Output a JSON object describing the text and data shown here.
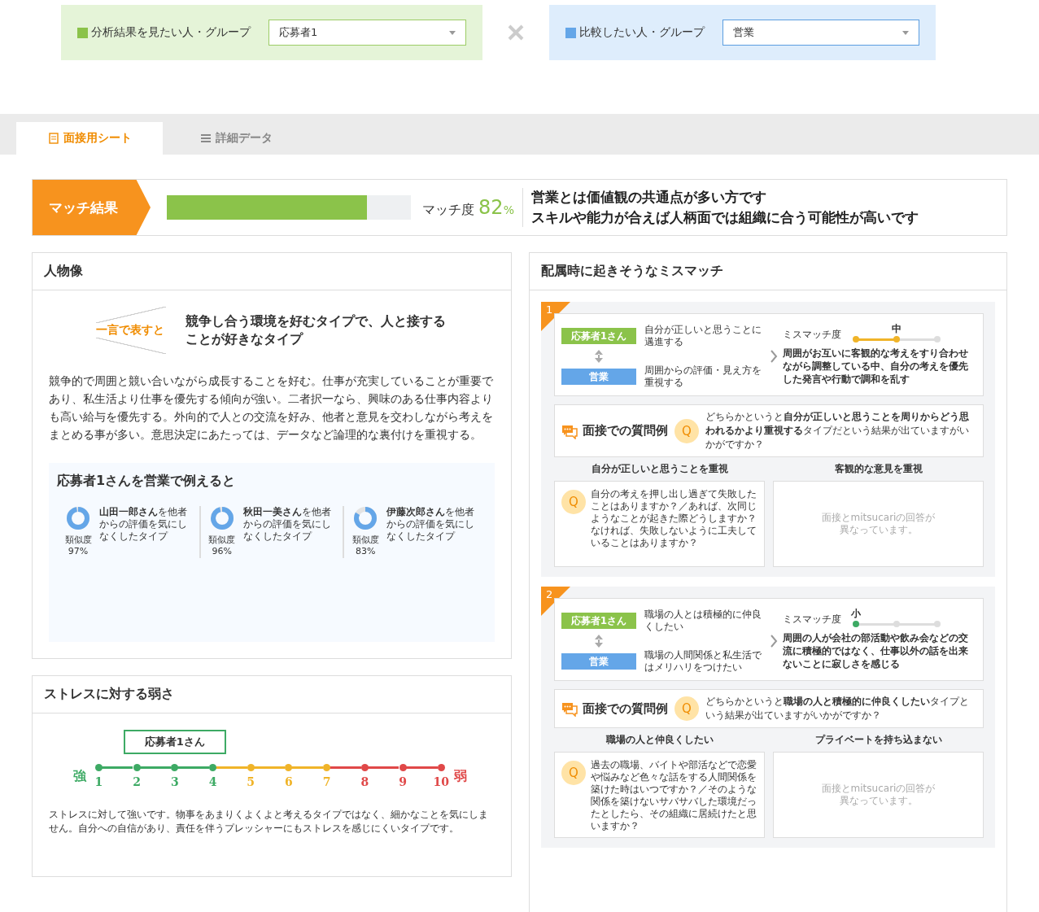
{
  "selectors": [
    {
      "label": "分析結果を見たい人・グループ",
      "value": "応募者1",
      "color": "#8bc34a"
    },
    {
      "label": "比較したい人・グループ",
      "value": "営業",
      "color": "#64a6e8"
    }
  ],
  "tabs": [
    {
      "label": "面接用シート",
      "kind": "sheet",
      "selected": true
    },
    {
      "label": "詳細データ",
      "kind": "list",
      "selected": false
    }
  ],
  "match": {
    "badge": "マッチ結果",
    "level": 0.82,
    "label": "マッチ度",
    "value": "82",
    "unit": "%",
    "summary": [
      "営業とは価値観の共通点が多い方です",
      "スキルや能力が合えば人柄面では組織に合う可能性が高いです"
    ]
  },
  "persona": {
    "title": "人物像",
    "tagline_label": "一言で表すと",
    "tagline": "競争し合う環境を好むタイプで、人と接することが好きなタイプ",
    "description": "競争的で周囲と競い合いながら成長することを好む。仕事が充実していることが重要であり、私生活より仕事を優先する傾向が強い。二者択一なら、興味のある仕事内容よりも高い給与を優先する。外向的で人との交流を好み、他者と意見を交わしながら考えをまとめる事が多い。意思決定にあたっては、データなど論理的な裏付けを重視する。",
    "examples_title": "応募者1さんを営業で例えると",
    "examples": [
      {
        "text": "**山田一郎さん**を他者からの評価を気にしなくしたタイプ",
        "similarity_label": "類似度",
        "similarity": "97%",
        "level": 0.97
      },
      {
        "text": "**秋田一美さん**を他者からの評価を気にしなくしたタイプ",
        "similarity_label": "類似度",
        "similarity": "96%",
        "level": 0.96
      },
      {
        "text": "**伊藤次郎さん**を他者からの評価を気にしなくしたタイプ",
        "similarity_label": "類似度",
        "similarity": "83%",
        "level": 0.83
      }
    ]
  },
  "stress": {
    "title": "ストレスに対する弱さ",
    "marker": "応募者1さん",
    "strong_label": "強",
    "weak_label": "弱",
    "points": [
      {
        "label": "1",
        "color": "#3daa64",
        "selected": false
      },
      {
        "label": "2",
        "color": "#3daa64",
        "selected": false
      },
      {
        "label": "3",
        "color": "#3daa64",
        "selected": true
      },
      {
        "label": "4",
        "color": "#3daa64",
        "selected": false
      },
      {
        "label": "5",
        "color": "#f0b429",
        "selected": false
      },
      {
        "label": "6",
        "color": "#f0b429",
        "selected": false
      },
      {
        "label": "7",
        "color": "#f0b429",
        "selected": false
      },
      {
        "label": "8",
        "color": "#e04848",
        "selected": false
      },
      {
        "label": "9",
        "color": "#e04848",
        "selected": false
      },
      {
        "label": "10",
        "color": "#e04848",
        "selected": false
      }
    ],
    "description": "ストレスに対して強いです。物事をあまりくよくよと考えるタイプではなく、細かなことを気にしません。自分への自信があり、責任を伴うプレッシャーにもストレスを感じにくいタイプです。"
  },
  "mismatch": {
    "title": "配属時に起きそうなミスマッチ",
    "items": [
      {
        "number": "1",
        "self_tag": "応募者1さん",
        "self_text": "自分が正しいと思うことに邁進する",
        "group_tag": "営業",
        "group_text": "周囲からの評価・見え方を重視する",
        "degree_label": "ミスマッチ度",
        "degree": "中",
        "level": 0.5,
        "color": "#f0b429",
        "effect": "周囲がお互いに客観的な考えをすり合わせながら調整している中、自分の考えを優先した発言や行動で調和を乱す",
        "question_title": "面接での質問例",
        "q_mark": "Q",
        "question": "どちらかというと**自分が正しいと思うことを周りからどう思われるかより重視する**タイプだという結果が出ていますがいかがですか？",
        "answers": [
          {
            "heading": "自分が正しいと思うことを重視",
            "kind": "question",
            "mark": "Q",
            "text": "自分の考えを押し出し過ぎて失敗したことはありますか？／あれば、次同じようなことが起きた際どうしますか？なければ、失敗しないように工夫していることはありますか？"
          },
          {
            "heading": "客観的な意見を重視",
            "kind": "note",
            "text": "面接とmitsucariの回答が異なっています。"
          }
        ]
      },
      {
        "number": "2",
        "self_tag": "応募者1さん",
        "self_text": "職場の人とは積極的に仲良くしたい",
        "group_tag": "営業",
        "group_text": "職場の人間関係と私生活ではメリハリをつけたい",
        "degree_label": "ミスマッチ度",
        "degree": "小",
        "level": 0,
        "color": "#3daa64",
        "effect": "周囲の人が会社の部活動や飲み会などの交流に積極的ではなく、仕事以外の話を出来ないことに寂しさを感じる",
        "question_title": "面接での質問例",
        "q_mark": "Q",
        "question": "どちらかというと**職場の人と積極的に仲良くしたい**タイプという結果が出ていますがいかがですか？",
        "answers": [
          {
            "heading": "職場の人と仲良くしたい",
            "kind": "question",
            "mark": "Q",
            "text": "過去の職場、バイトや部活などで恋愛や悩みなど色々な話をする人間関係を築けた時はいつですか？／そのような関係を築けないサバサバした環境だったとしたら、その組織に居続けたと思いますか？"
          },
          {
            "heading": "プライベートを持ち込まない",
            "kind": "note",
            "text": "面接とmitsucariの回答が異なっています。"
          }
        ]
      }
    ]
  }
}
